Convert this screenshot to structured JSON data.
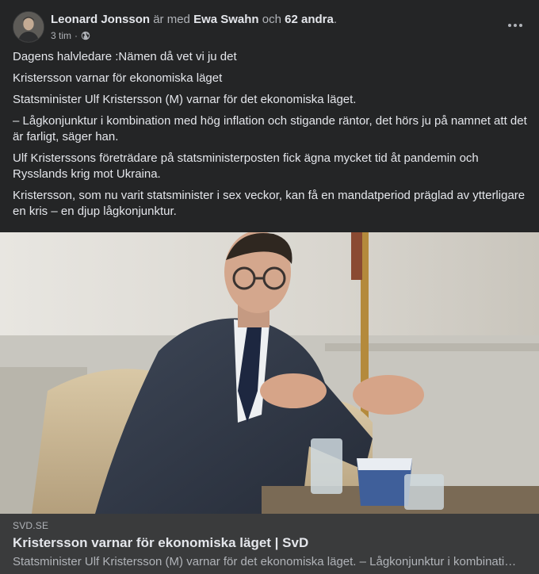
{
  "header": {
    "author": "Leonard Jonsson",
    "with_text": " är med ",
    "tagged": "Ewa Swahn",
    "and_text": " och ",
    "others": "62 andra",
    "period": ".",
    "time": "3 tim",
    "dot": "·",
    "privacy_icon": "globe-icon",
    "more_icon": "more-horizontal-icon"
  },
  "post": {
    "paragraphs": [
      "Dagens halvledare :Nämen då vet vi ju det",
      "Kristersson varnar för ekonomiska läget",
      "Statsminister Ulf Kristersson (M) varnar för det ekonomiska läget.",
      "– Lågkonjunktur i kombination med hög inflation och stigande räntor, det hörs ju på namnet att det är farligt, säger han.",
      "Ulf Kristerssons företrädare på statsministerposten fick ägna mycket tid åt pandemin och Rysslands krig mot Ukraina.",
      "Kristersson, som nu varit statsminister i sex veckor, kan få en mandatperiod präglad av ytterligare en kris – en djup lågkonjunktur."
    ]
  },
  "link": {
    "domain": "SVD.SE",
    "title": "Kristersson varnar för ekonomiska läget | SvD",
    "description": "Statsminister Ulf Kristersson (M) varnar för det ekonomiska läget. – Lågkonjunktur i kombination med hög inflation och stigande räntor, det hörs ju på namnet att det är farligt, säger han."
  },
  "colors": {
    "background": "#242526",
    "card": "#3a3b3c",
    "primary_text": "#e4e6eb",
    "secondary_text": "#b0b3b8"
  }
}
